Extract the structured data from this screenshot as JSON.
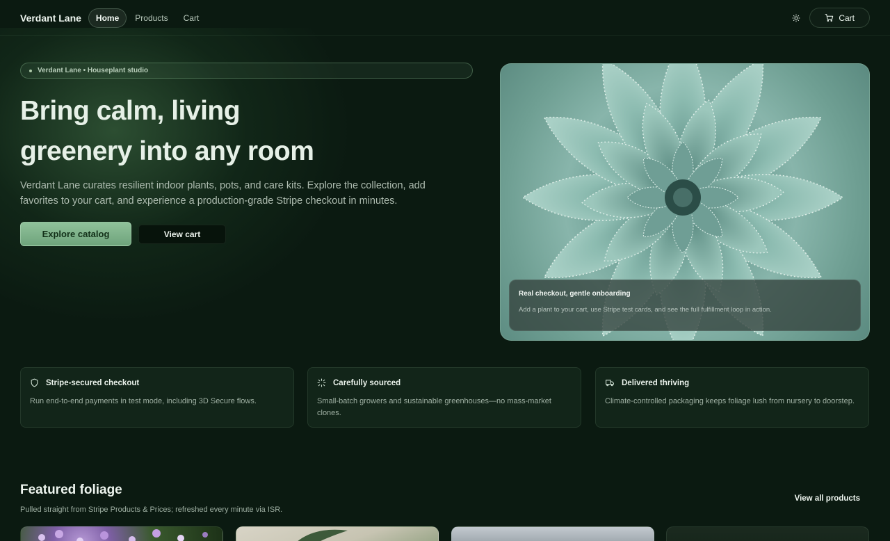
{
  "nav": {
    "brand": "Verdant Lane",
    "links": [
      "Home",
      "Products",
      "Cart"
    ],
    "active": "Home",
    "theme_icon": "sun-icon",
    "cart_label": "Cart",
    "cart_icon": "cart-icon"
  },
  "hero": {
    "badge": "Verdant Lane • Houseplant studio",
    "title_line1": "Bring calm, living",
    "title_line2": "greenery into any room",
    "description": "Verdant Lane curates resilient indoor plants, pots, and care kits. Explore the collection, add favorites to your cart, and experience a production-grade Stripe checkout in minutes.",
    "primary_cta": "Explore catalog",
    "secondary_cta": "View cart",
    "image_card": {
      "title": "Real checkout, gentle onboarding",
      "text": "Add a plant to your cart, use Stripe test cards, and see the full fulfillment loop in action."
    }
  },
  "features": [
    {
      "icon": "shield-icon",
      "title": "Stripe-secured checkout",
      "description": "Run end-to-end payments in test mode, including 3D Secure flows."
    },
    {
      "icon": "sparkle-icon",
      "title": "Carefully sourced",
      "description": "Small-batch growers and sustainable greenhouses—no mass-market clones."
    },
    {
      "icon": "truck-icon",
      "title": "Delivered thriving",
      "description": "Climate-controlled packaging keeps foliage lush from nursery to doorstep."
    }
  ],
  "featured": {
    "title": "Featured foliage",
    "subtitle": "Pulled straight from Stripe Products & Prices; refreshed every minute via ISR.",
    "view_all": "View all products"
  },
  "colors": {
    "background": "#0b1a11",
    "accent": "#8fc19a",
    "card": "#122519"
  }
}
